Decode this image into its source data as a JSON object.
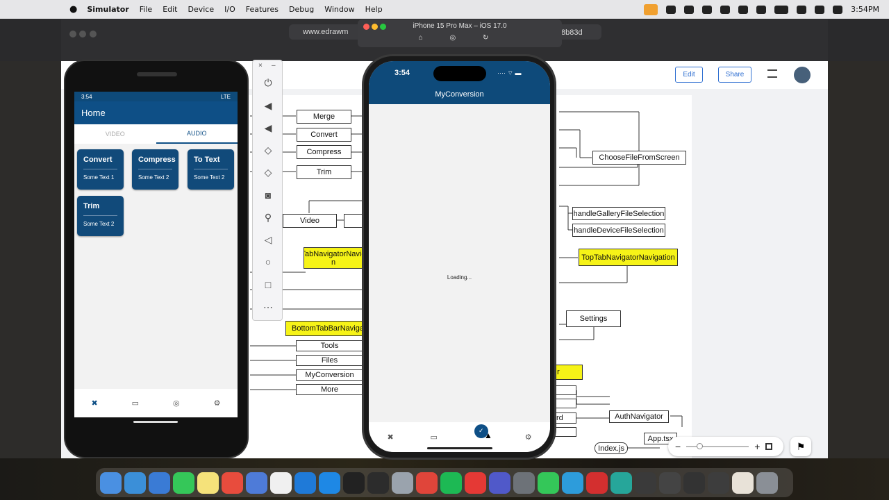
{
  "menubar": {
    "apple": "",
    "app": "Simulator",
    "menus": [
      "File",
      "Edit",
      "Device",
      "I/O",
      "Features",
      "Debug",
      "Window",
      "Help"
    ],
    "clock": "3:54PM"
  },
  "browser": {
    "url": "www.edrawm",
    "url_tail": "8b83d"
  },
  "simulator_window": {
    "title": "iPhone 15 Pro Max – iOS 17.0"
  },
  "doc_header": {
    "edit": "Edit",
    "share": "Share"
  },
  "diagram": {
    "nodes": {
      "merge": "Merge",
      "convert": "Convert",
      "compress": "Compress",
      "trim": "Trim",
      "video": "Video",
      "top_tab_left": "TopTabNavigatorNavigatio n",
      "bottom_tab": "BottomTabBarNavigato",
      "tools": "Tools",
      "files": "Files",
      "my_conversion": "MyConversion",
      "more": "More",
      "choose_file": "ChooseFileFromScreen",
      "gallery": "handleGalleryFileSelection",
      "device": "handleDeviceFileSelection",
      "top_tab_right": "TopTabNavigatorNavigation",
      "settings": "Settings",
      "auth": "AuthNavigator",
      "app_tsx": "App.tsx",
      "index_js": "Index.js",
      "partial_rd": "rd",
      "partial_r": "r"
    }
  },
  "zoom": {
    "minus": "−",
    "plus": "+"
  },
  "android": {
    "time": "3:54",
    "signal": "LTE",
    "title": "Home",
    "tabs": [
      "VIDEO",
      "AUDIO"
    ],
    "cards": [
      {
        "title": "Convert",
        "sub": "Some Text 1"
      },
      {
        "title": "Compress",
        "sub": "Some Text 2"
      },
      {
        "title": "To Text",
        "sub": "Some Text 2"
      },
      {
        "title": "Trim",
        "sub": "Some Text 2"
      }
    ]
  },
  "iphone": {
    "time": "3:54",
    "title": "MyConversion",
    "loading": "Loading..."
  }
}
